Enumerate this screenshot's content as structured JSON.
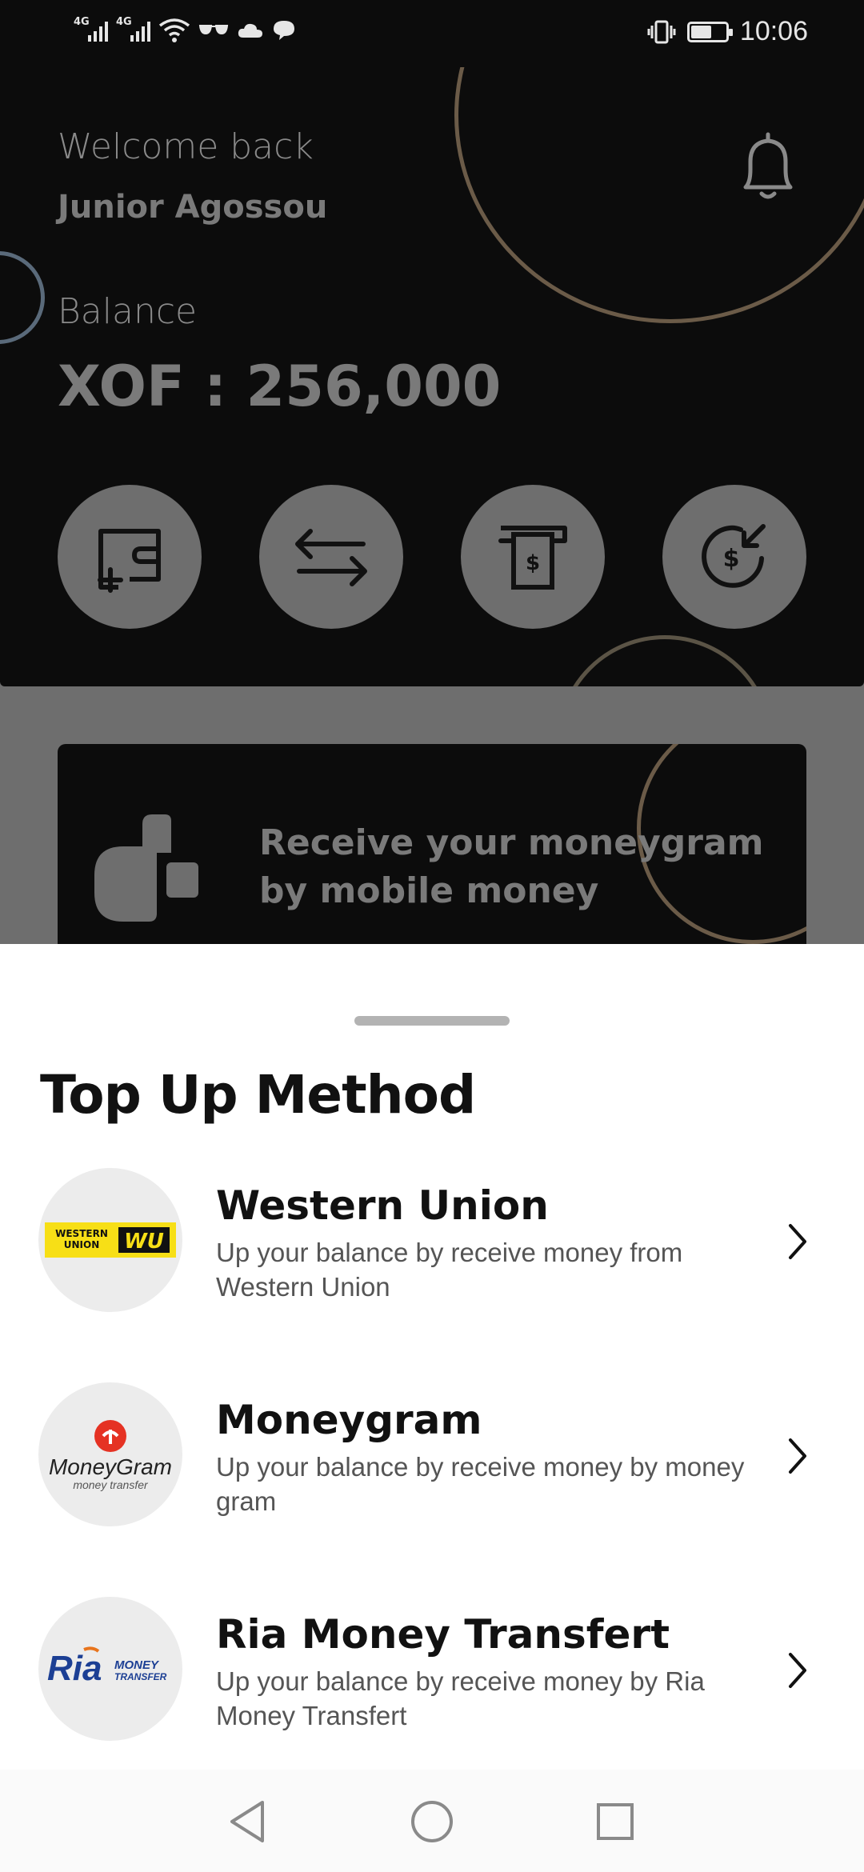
{
  "status_bar": {
    "network_1": "4G",
    "network_2": "4G",
    "time": "10:06",
    "icons": [
      "signal-icon",
      "signal-icon",
      "wifi-icon",
      "glasses-icon",
      "cloud-icon",
      "chat-icon",
      "vibrate-icon",
      "battery-icon"
    ]
  },
  "header": {
    "welcome": "Welcome back",
    "user_name": "Junior Agossou",
    "balance_label": "Balance",
    "balance_value": "XOF : 256,000",
    "actions": [
      {
        "icon": "wallet-add-icon"
      },
      {
        "icon": "transfer-arrows-icon"
      },
      {
        "icon": "atm-withdraw-icon"
      },
      {
        "icon": "receive-money-icon"
      }
    ],
    "colors": {
      "background": "#0c0c0c",
      "ring": "#6b5b48"
    }
  },
  "promo": {
    "text": "Receive your moneygram by mobile money"
  },
  "sheet": {
    "title": "Top Up Method",
    "methods": [
      {
        "title": "Western Union",
        "description": "Up your balance by receive money from Western Union",
        "logo_text_1": "WESTERN",
        "logo_text_2": "UNION",
        "logo_mark": "WU"
      },
      {
        "title": "Moneygram",
        "description": "Up your balance by receive money by money gram",
        "logo_text": "MoneyGram",
        "logo_sub": "money transfer"
      },
      {
        "title": "Ria Money Transfert",
        "description": "Up your balance by receive money by Ria Money Transfert",
        "logo_text": "Ria",
        "logo_sub_1": "MONEY",
        "logo_sub_2": "TRANSFER"
      }
    ]
  },
  "navbar": {
    "buttons": [
      "back-icon",
      "home-icon",
      "recents-icon"
    ]
  }
}
